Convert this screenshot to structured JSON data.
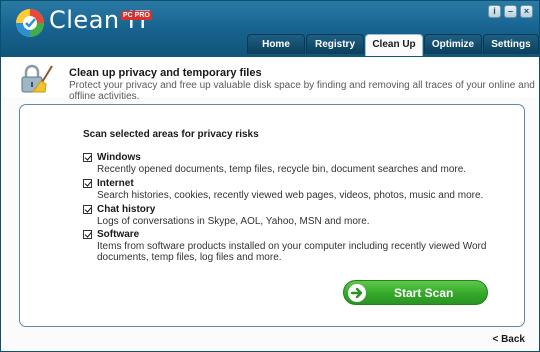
{
  "app": {
    "title": "Clean IT",
    "edition": "PC PRO",
    "window_buttons": [
      "i",
      "–",
      "×"
    ]
  },
  "tabs": [
    {
      "label": "Home",
      "active": false
    },
    {
      "label": "Registry",
      "active": false
    },
    {
      "label": "Clean Up",
      "active": true
    },
    {
      "label": "Optimize",
      "active": false
    },
    {
      "label": "Settings",
      "active": false
    }
  ],
  "header": {
    "title": "Clean up privacy and temporary files",
    "subtitle": "Protect your privacy and free up valuable disk space by finding and removing all traces of your online and offline activities."
  },
  "panel": {
    "heading": "Scan selected areas for privacy risks",
    "options": [
      {
        "title": "Windows",
        "checked": true,
        "description": "Recently opened documents, temp files, recycle bin, document searches and more."
      },
      {
        "title": "Internet",
        "checked": true,
        "description": "Search histories, cookies, recently viewed web pages, videos, photos, music and more."
      },
      {
        "title": "Chat history",
        "checked": true,
        "description": "Logs of conversations in Skype, AOL, Yahoo, MSN and more."
      },
      {
        "title": "Software",
        "checked": true,
        "description": "Items from software products installed on your computer including recently viewed Word documents, temp files, log files and more."
      }
    ],
    "scan_button": "Start Scan"
  },
  "footer": {
    "back_label": "< Back"
  },
  "colors": {
    "titlebar": "#17638f",
    "tab_dark": "#0c3f5c",
    "accent_green": "#34a82a",
    "panel_border": "#5f8aa8"
  }
}
